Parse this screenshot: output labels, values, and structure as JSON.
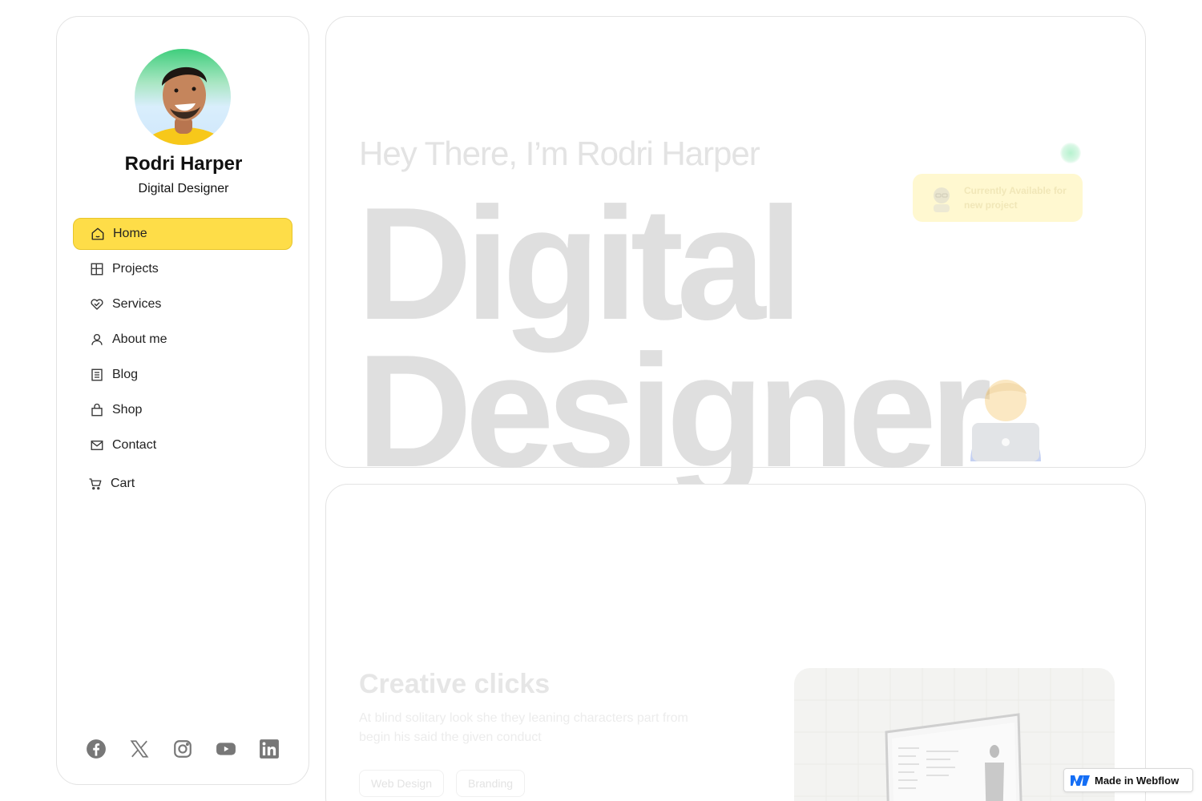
{
  "profile": {
    "name": "Rodri Harper",
    "role": "Digital Designer"
  },
  "nav": {
    "items": [
      {
        "label": "Home",
        "icon": "home-icon",
        "active": true
      },
      {
        "label": "Projects",
        "icon": "grid-icon"
      },
      {
        "label": "Services",
        "icon": "heart-handshake-icon"
      },
      {
        "label": "About me",
        "icon": "user-icon"
      },
      {
        "label": "Blog",
        "icon": "document-icon"
      },
      {
        "label": "Shop",
        "icon": "shopping-bag-icon"
      },
      {
        "label": "Contact",
        "icon": "mail-icon"
      },
      {
        "label": "Cart",
        "icon": "cart-icon"
      }
    ]
  },
  "socials": [
    "facebook-icon",
    "x-icon",
    "instagram-icon",
    "youtube-icon",
    "linkedin-icon"
  ],
  "hero": {
    "intro": "Hey There, I’m Rodri Harper",
    "headline_line1": "Digital",
    "headline_line2": "Designer",
    "availability": "Currently Available for new project"
  },
  "project": {
    "title": "Creative clicks",
    "description": "At blind solitary look she they leaning characters part from begin his said the given conduct",
    "tags": [
      "Web Design",
      "Branding"
    ]
  },
  "badge": {
    "label": "Made in Webflow"
  },
  "colors": {
    "accent": "#fedd48",
    "accent_border": "#e7c52a",
    "card_border": "#e3e3e3",
    "faded_text": "#dfdfdf"
  }
}
